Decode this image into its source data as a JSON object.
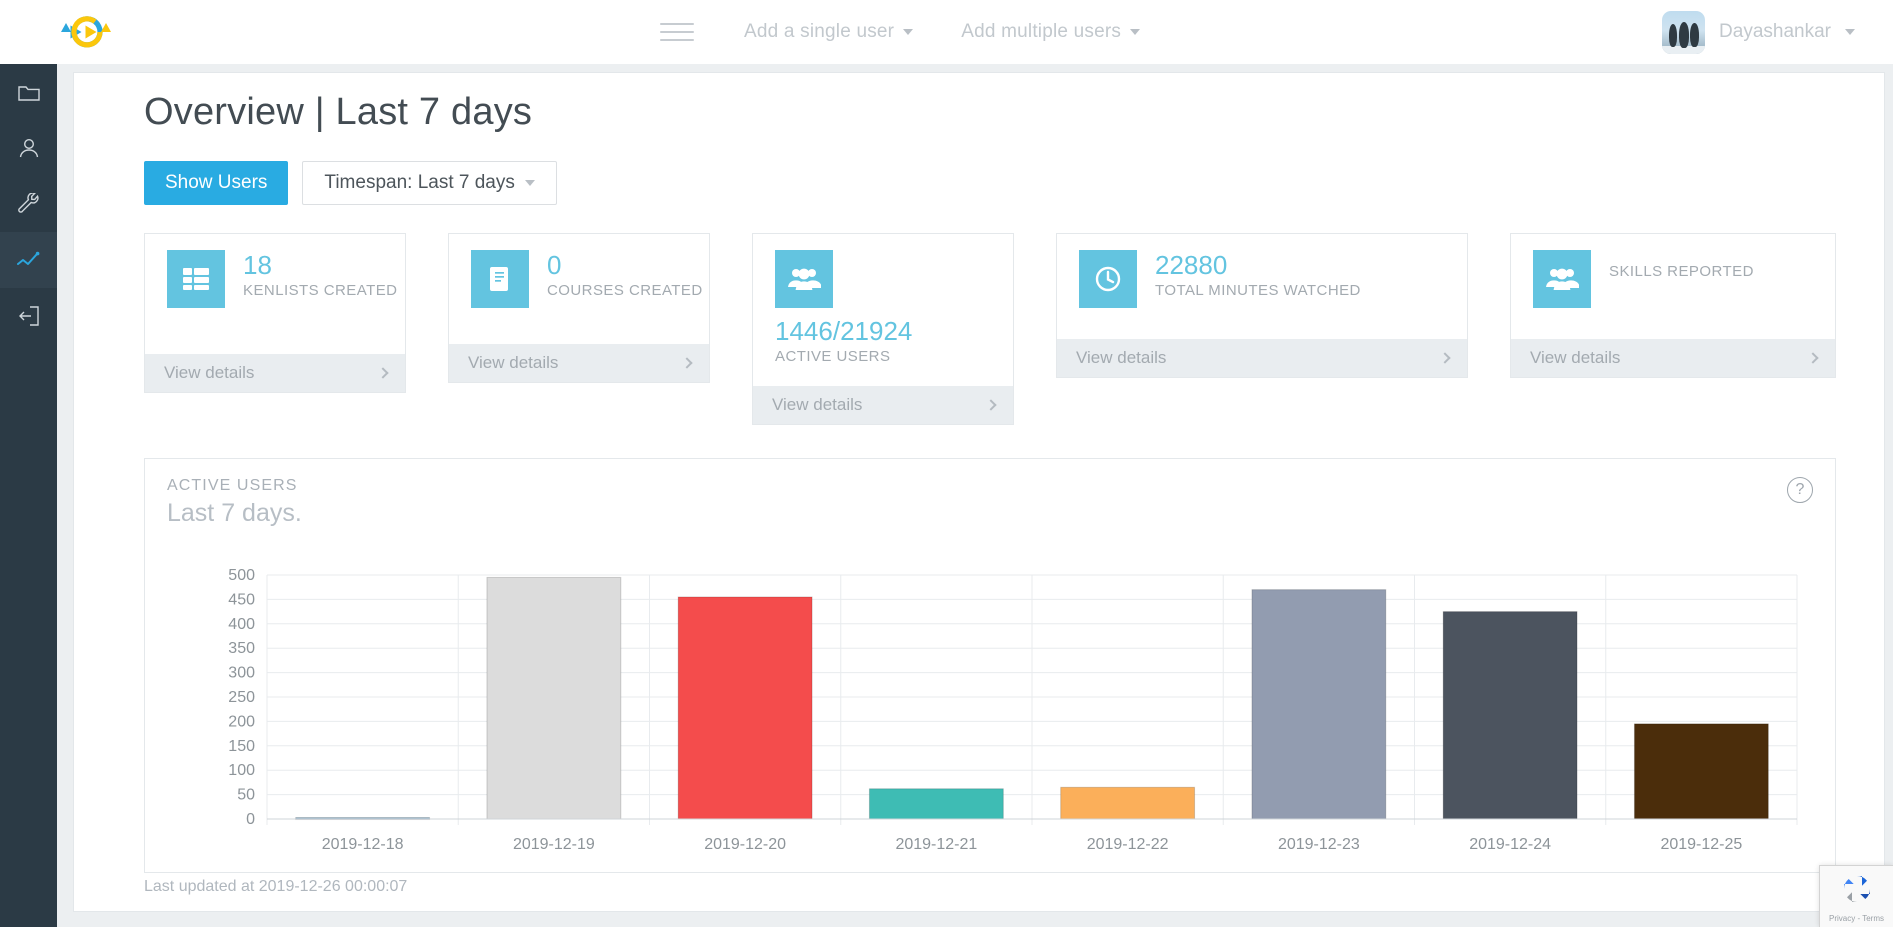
{
  "header": {
    "logo_name": "kenhub-logo",
    "menu_icon": "hamburger-icon",
    "nav": [
      {
        "label": "Add a single user"
      },
      {
        "label": "Add multiple users"
      }
    ],
    "user": {
      "name": "Dayashankar",
      "avatar_alt": "penguins-avatar"
    }
  },
  "sidebar": {
    "items": [
      {
        "name": "folder",
        "label": "Folder"
      },
      {
        "name": "user",
        "label": "User"
      },
      {
        "name": "wrench",
        "label": "Settings"
      },
      {
        "name": "chart",
        "label": "Analytics",
        "active": true
      },
      {
        "name": "logout",
        "label": "Logout"
      }
    ]
  },
  "page": {
    "title": "Overview | Last 7 days",
    "show_users_button": "Show Users",
    "timespan_button": "Timespan: Last 7 days",
    "updated_text": "Last updated at 2019-12-26 00:00:07"
  },
  "stats": [
    {
      "value": "18",
      "label": "KENLISTS CREATED",
      "icon": "grid-icon",
      "footer": "View details"
    },
    {
      "value": "0",
      "label": "COURSES CREATED",
      "icon": "book-icon",
      "footer": "View details"
    },
    {
      "value": "1446/21924",
      "label": "ACTIVE USERS",
      "icon": "people-icon",
      "footer": "View details"
    },
    {
      "value": "22880",
      "label": "TOTAL MINUTES WATCHED",
      "icon": "clock-icon",
      "footer": "View details"
    },
    {
      "value": "",
      "label": "SKILLS REPORTED",
      "icon": "people-icon",
      "footer": "View details"
    }
  ],
  "chart_panel": {
    "kicker": "ACTIVE USERS",
    "subtitle": "Last 7 days.",
    "help_icon": "question-mark-icon",
    "help_label": "?"
  },
  "chart_data": {
    "type": "bar",
    "title": "ACTIVE USERS",
    "subtitle": "Last 7 days.",
    "xlabel": "",
    "ylabel": "",
    "ylim": [
      0,
      500
    ],
    "yticks": [
      0,
      50,
      100,
      150,
      200,
      250,
      300,
      350,
      400,
      450,
      500
    ],
    "grid": true,
    "legend": "none",
    "categories": [
      "2019-12-18",
      "2019-12-19",
      "2019-12-20",
      "2019-12-21",
      "2019-12-22",
      "2019-12-23",
      "2019-12-24",
      "2019-12-25"
    ],
    "values": [
      3,
      495,
      455,
      62,
      65,
      470,
      425,
      195
    ],
    "colors": [
      "#8fb4cc",
      "#dcdcdc",
      "#f44c4c",
      "#3ebcb4",
      "#fbaf5a",
      "#929cb0",
      "#4c545f",
      "#4b2d0b"
    ]
  },
  "recaptcha": {
    "text": "Privacy - Terms",
    "icon": "recaptcha-icon"
  }
}
